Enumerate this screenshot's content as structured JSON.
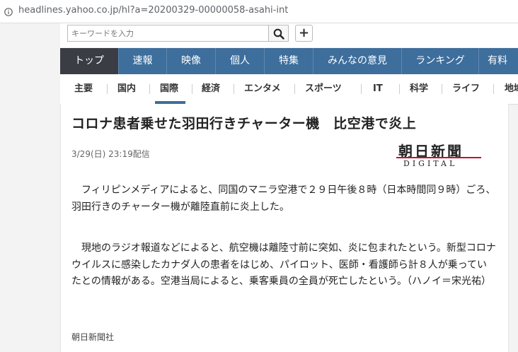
{
  "browser": {
    "url": "headlines.yahoo.co.jp/hl?a=20200329-00000058-asahi-int"
  },
  "search": {
    "placeholder": "キーワードを入力"
  },
  "main_nav": {
    "tabs": [
      {
        "label": "トップ",
        "active": true
      },
      {
        "label": "速報",
        "active": false
      },
      {
        "label": "映像",
        "active": false
      },
      {
        "label": "個人",
        "active": false
      },
      {
        "label": "特集",
        "active": false
      },
      {
        "label": "みんなの意見",
        "active": false
      },
      {
        "label": "ランキング",
        "active": false
      },
      {
        "label": "有料",
        "active": false
      }
    ]
  },
  "sub_nav": {
    "items": [
      {
        "label": "主要",
        "active": false
      },
      {
        "label": "国内",
        "active": false
      },
      {
        "label": "国際",
        "active": true
      },
      {
        "label": "経済",
        "active": false
      },
      {
        "label": "エンタメ",
        "active": false
      },
      {
        "label": "スポーツ",
        "active": false
      },
      {
        "label": "IT",
        "active": false
      },
      {
        "label": "科学",
        "active": false
      },
      {
        "label": "ライフ",
        "active": false
      },
      {
        "label": "地域",
        "active": false
      }
    ]
  },
  "article": {
    "headline": "コロナ患者乗せた羽田行きチャーター機　比空港で炎上",
    "date": "3/29(日) 23:19配信",
    "publisher_logo": {
      "kanji": "朝日新聞",
      "sub": "DIGITAL"
    },
    "paragraphs": [
      "フィリピンメディアによると、同国のマニラ空港で２９日午後８時（日本時間同９時）ごろ、羽田行きのチャーター機が離陸直前に炎上した。",
      "現地のラジオ報道などによると、航空機は離陸寸前に突如、炎に包まれたという。新型コロナウイルスに感染したカナダ人の患者をはじめ、パイロット、医師・看護師ら計８人が乗っていたとの情報がある。空港当局によると、乗客乗員の全員が死亡したという。（ハノイ＝宋光祐）"
    ],
    "source": "朝日新聞社"
  },
  "colors": {
    "nav_blue": "#3d6e9c",
    "nav_active": "#3a3d44",
    "logo_red": "#c8102e"
  }
}
